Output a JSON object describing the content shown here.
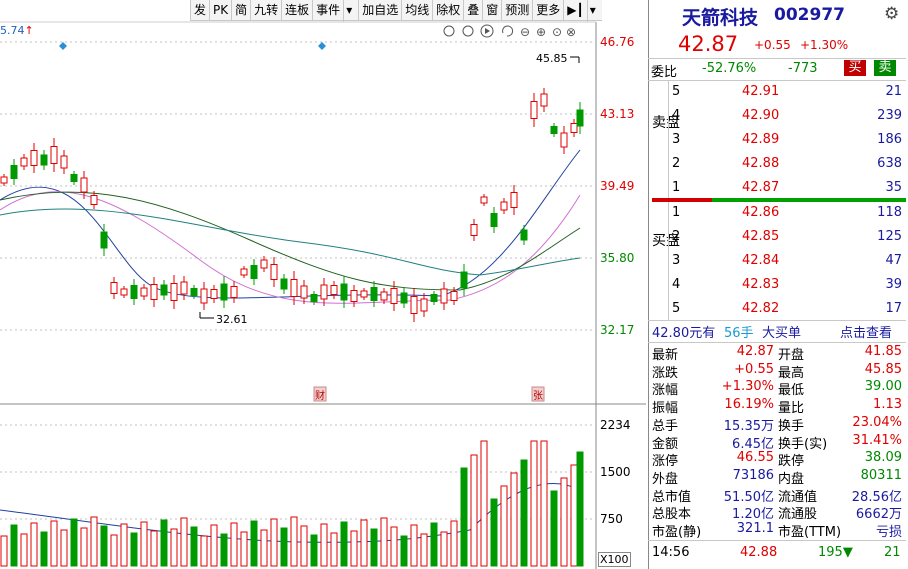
{
  "toolbar": {
    "items": [
      "发",
      "PK",
      "简",
      "九转",
      "连板",
      "事件",
      "▾",
      "加自选",
      "均线",
      "除权",
      "叠",
      "窗",
      "预测",
      "更多",
      "▶┃",
      "▾"
    ]
  },
  "chart": {
    "top_left_price": "5.74",
    "axis_labels": [
      "46.76",
      "43.13",
      "39.49",
      "35.80",
      "32.17"
    ],
    "vol_axis_labels": [
      "2234",
      "1500",
      "750"
    ],
    "x100_label": "X100",
    "high_annotation": "45.85",
    "low_annotation": "32.61",
    "event_marks": [
      "财",
      "张"
    ]
  },
  "colors": {
    "up": "#e00000",
    "down": "#008800",
    "accent_blue": "#1a1aa0"
  },
  "header": {
    "name": "天箭科技",
    "code": "002977",
    "price": "42.87",
    "change": "+0.55",
    "change_pct": "+1.30%"
  },
  "weibi": {
    "label": "委比",
    "pct": "-52.76%",
    "diff": "-773",
    "buy_btn": "买",
    "sell_btn": "卖"
  },
  "sell_label": "卖盘",
  "buy_label": "买盘",
  "sell_book": [
    {
      "lvl": "5",
      "price": "42.91",
      "vol": "21"
    },
    {
      "lvl": "4",
      "price": "42.90",
      "vol": "239"
    },
    {
      "lvl": "3",
      "price": "42.89",
      "vol": "186"
    },
    {
      "lvl": "2",
      "price": "42.88",
      "vol": "638"
    },
    {
      "lvl": "1",
      "price": "42.87",
      "vol": "35"
    }
  ],
  "buy_book": [
    {
      "lvl": "1",
      "price": "42.86",
      "vol": "118"
    },
    {
      "lvl": "2",
      "price": "42.85",
      "vol": "125"
    },
    {
      "lvl": "3",
      "price": "42.84",
      "vol": "47"
    },
    {
      "lvl": "4",
      "price": "42.83",
      "vol": "39"
    },
    {
      "lvl": "5",
      "price": "42.82",
      "vol": "17"
    }
  ],
  "big_order": {
    "price": "42.80元有",
    "qty": "56手",
    "type": "大买单",
    "link": "点击查看"
  },
  "stats": [
    {
      "l1": "最新",
      "v1": "42.87",
      "l2": "开盘",
      "v2": "41.85"
    },
    {
      "l1": "涨跌",
      "v1": "+0.55",
      "l2": "最高",
      "v2": "45.85"
    },
    {
      "l1": "涨幅",
      "v1": "+1.30%",
      "l2": "最低",
      "v2": "39.00"
    },
    {
      "l1": "振幅",
      "v1": "16.19%",
      "l2": "量比",
      "v2": "1.13"
    },
    {
      "l1": "总手",
      "v1": "15.35万",
      "l2": "换手",
      "v2": "23.04%"
    },
    {
      "l1": "金额",
      "v1": "6.45亿",
      "l2": "换手(实)",
      "v2": "31.41%"
    },
    {
      "l1": "涨停",
      "v1": "46.55",
      "l2": "跌停",
      "v2": "38.09"
    },
    {
      "l1": "外盘",
      "v1": "73186",
      "l2": "内盘",
      "v2": "80311"
    },
    {
      "l1": "总市值",
      "v1": "51.50亿",
      "l2": "流通值",
      "v2": "28.56亿"
    },
    {
      "l1": "总股本",
      "v1": "1.20亿",
      "l2": "流通股",
      "v2": "6662万"
    },
    {
      "l1": "市盈(静)",
      "v1": "321.1",
      "l2": "市盈(TTM)",
      "v2": "亏损"
    }
  ],
  "tick": {
    "time": "14:56",
    "price": "42.88",
    "vol": "195",
    "count": "21"
  }
}
